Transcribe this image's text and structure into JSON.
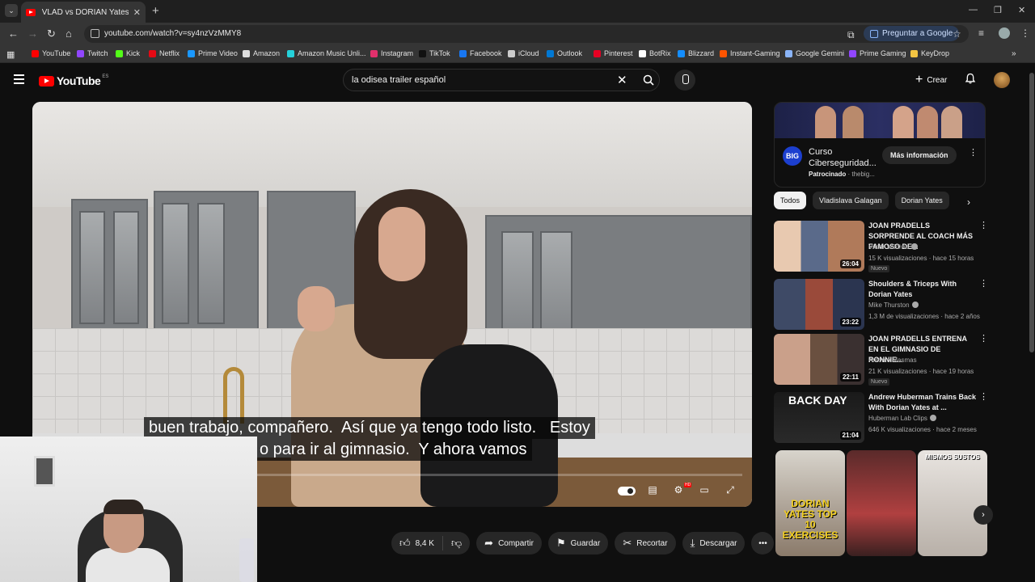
{
  "browser": {
    "tab_title": "VLAD vs DORIAN Yates - YouTube",
    "url": "youtube.com/watch?v=sy4nzVzMMY8",
    "ask_google": "Preguntar a Google",
    "bookmarks": [
      {
        "label": "YouTube",
        "color": "#ff0000"
      },
      {
        "label": "Twitch",
        "color": "#9146ff"
      },
      {
        "label": "Kick",
        "color": "#53fc18"
      },
      {
        "label": "Netflix",
        "color": "#e50914"
      },
      {
        "label": "Prime Video",
        "color": "#1a98ff"
      },
      {
        "label": "Amazon",
        "color": "#dddddd"
      },
      {
        "label": "Amazon Music Unli...",
        "color": "#25d1da"
      },
      {
        "label": "Instagram",
        "color": "#e1306c"
      },
      {
        "label": "TikTok",
        "color": "#111111"
      },
      {
        "label": "Facebook",
        "color": "#1877f2"
      },
      {
        "label": "iCloud",
        "color": "#cccccc"
      },
      {
        "label": "Outlook",
        "color": "#0078d4"
      },
      {
        "label": "Pinterest",
        "color": "#e60023"
      },
      {
        "label": "BotRix",
        "color": "#ffffff"
      },
      {
        "label": "Blizzard",
        "color": "#148eff"
      },
      {
        "label": "Instant-Gaming",
        "color": "#ff5400"
      },
      {
        "label": "Google Gemini",
        "color": "#8ab4f8"
      },
      {
        "label": "Prime Gaming",
        "color": "#9146ff"
      },
      {
        "label": "KeyDrop",
        "color": "#f4c542"
      }
    ]
  },
  "youtube": {
    "logo": "YouTube",
    "country": "ES",
    "search_query": "la odisea trailer español",
    "create_label": "Crear"
  },
  "video": {
    "subtitle_line1": "buen trabajo, compañero.  Así que ya tengo todo listo.   Estoy",
    "subtitle_line2": "o para ir al gimnasio.  Y ahora vamos",
    "progress": 0.0
  },
  "actions": {
    "likes": "8,4 K",
    "share": "Compartir",
    "save": "Guardar",
    "clip": "Recortar",
    "download": "Descargar"
  },
  "ad": {
    "title": "Curso Ciberseguridad...",
    "sponsored": "Patrocinado",
    "advertiser": "thebig...",
    "cta": "Más información",
    "logo": "BIG"
  },
  "chips": [
    "Todos",
    "Vladislava Galagan",
    "Dorian Yates"
  ],
  "recommendations": [
    {
      "title": "JOAN PRADELLS SORPRENDE AL COACH MÁS FAMOSO DE...",
      "channel": "Victor Valdivia",
      "meta": "15 K visualizaciones · hace 15 horas",
      "badge": "Nuevo",
      "duration": "26:04"
    },
    {
      "title": "Shoulders & Triceps With Dorian Yates",
      "channel": "Mike Thurston",
      "meta": "1,3 M de visualizaciones · hace 2 años",
      "badge": "",
      "duration": "23:22"
    },
    {
      "title": "JOAN PRADELLS ENTRENA EN EL GIMNASIO DE RONNIE...",
      "channel": "Antonio Masmas",
      "meta": "21 K visualizaciones · hace 19 horas",
      "badge": "Nuevo",
      "duration": "22:11"
    },
    {
      "title": "Andrew Huberman Trains Back With Dorian Yates at ...",
      "channel": "Huberman Lab Clips",
      "meta": "646 K visualizaciones · hace 2 meses",
      "badge": "",
      "duration": "21:04",
      "thumb_text": "BACK DAY"
    }
  ],
  "shorts": [
    {
      "overlay": "DORIAN YATES TOP 10 EXERCISES"
    },
    {
      "overlay": ""
    },
    {
      "overlay": "MISMOS SUSTOS"
    }
  ]
}
